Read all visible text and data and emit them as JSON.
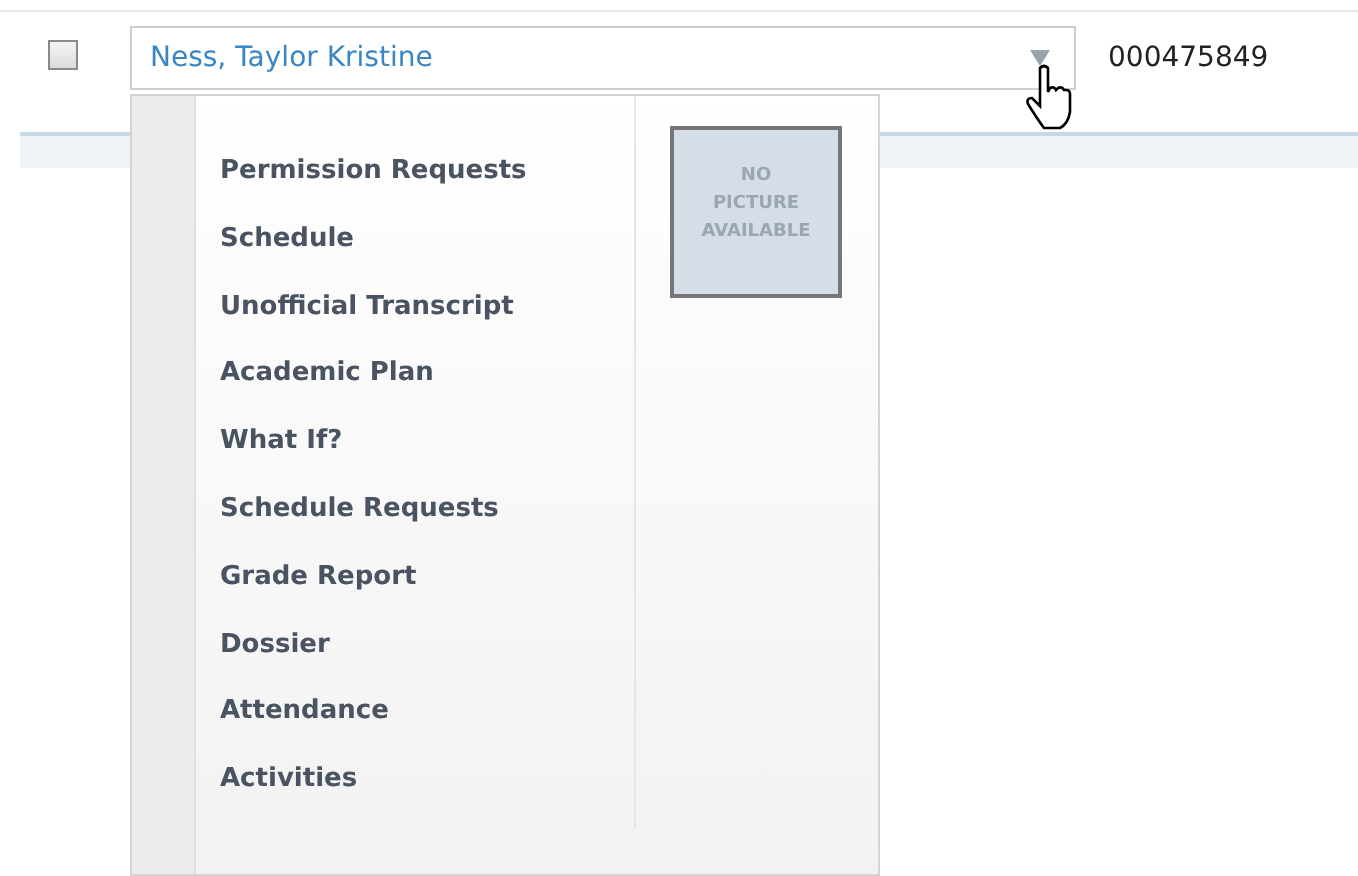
{
  "row": {
    "checked": false,
    "student_name": "Ness, Taylor Kristine",
    "student_id": "000475849"
  },
  "menu": {
    "items": [
      {
        "label": "Permission Requests"
      },
      {
        "label": "Schedule"
      },
      {
        "label": "Unofficial Transcript"
      },
      {
        "label": "Academic Plan"
      },
      {
        "label": "What If?"
      },
      {
        "label": "Schedule Requests"
      },
      {
        "label": "Grade Report"
      },
      {
        "label": "Dossier"
      },
      {
        "label": "Attendance"
      },
      {
        "label": "Activities"
      }
    ],
    "photo_placeholder": "NO PICTURE AVAILABLE"
  }
}
